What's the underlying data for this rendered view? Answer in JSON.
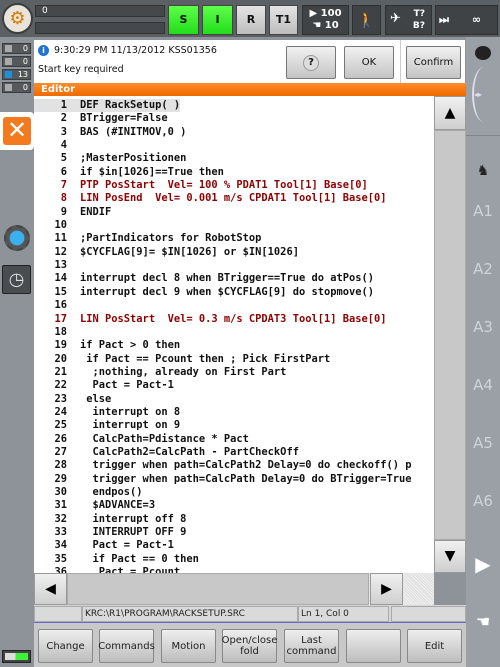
{
  "topbar": {
    "status_line1": "0",
    "status_line2": "",
    "submit_label": "S",
    "interpreter_label": "I",
    "robot_label": "R",
    "mode_label": "T1",
    "program_override": "100",
    "jog_override": "10",
    "tool_label": "T?",
    "base_label": "B?",
    "increment_label": "∞"
  },
  "left": {
    "counters": [
      {
        "icon": "ack-icon",
        "value": "0"
      },
      {
        "icon": "status-icon",
        "value": "0"
      },
      {
        "icon": "info-icon",
        "value": "13"
      },
      {
        "icon": "wait-icon",
        "value": "0"
      }
    ]
  },
  "message": {
    "icon": "info-icon",
    "header": "9:30:29 PM 11/13/2012 KSS01356",
    "text": "Start key required",
    "help_label": "?",
    "ok_label": "OK",
    "confirm_all_label": "Confirm all"
  },
  "editor": {
    "title": "Editor",
    "lines": [
      {
        "n": "1",
        "t": "DEF RackSetup( )"
      },
      {
        "n": "2",
        "t": "BTrigger=False"
      },
      {
        "n": "3",
        "t": "BAS (#INITMOV,0 )"
      },
      {
        "n": "4",
        "t": ""
      },
      {
        "n": "5",
        "t": ";MasterPositionen"
      },
      {
        "n": "6",
        "t": "if $in[1026]==True then"
      },
      {
        "n": "7",
        "t": "PTP PosStart  Vel= 100 % PDAT1 Tool[1] Base[0]",
        "red": true
      },
      {
        "n": "8",
        "t": "LIN PosEnd  Vel= 0.001 m/s CPDAT1 Tool[1] Base[0]",
        "red": true
      },
      {
        "n": "9",
        "t": "ENDIF"
      },
      {
        "n": "10",
        "t": ""
      },
      {
        "n": "11",
        "t": ";PartIndicators for RobotStop"
      },
      {
        "n": "12",
        "t": "$CYCFLAG[9]= $IN[1026] or $IN[1026]"
      },
      {
        "n": "13",
        "t": ""
      },
      {
        "n": "14",
        "t": "interrupt decl 8 when BTrigger==True do atPos()"
      },
      {
        "n": "15",
        "t": "interrupt decl 9 when $CYCFLAG[9] do stopmove()"
      },
      {
        "n": "16",
        "t": ""
      },
      {
        "n": "17",
        "t": "LIN PosStart  Vel= 0.3 m/s CPDAT3 Tool[1] Base[0]",
        "red": true
      },
      {
        "n": "18",
        "t": ""
      },
      {
        "n": "19",
        "t": "if Pact > 0 then"
      },
      {
        "n": "20",
        "t": " if Pact == Pcount then ; Pick FirstPart"
      },
      {
        "n": "21",
        "t": "  ;nothing, already on First Part"
      },
      {
        "n": "22",
        "t": "  Pact = Pact-1"
      },
      {
        "n": "23",
        "t": " else"
      },
      {
        "n": "24",
        "t": "  interrupt on 8"
      },
      {
        "n": "25",
        "t": "  interrupt on 9"
      },
      {
        "n": "26",
        "t": "  CalcPath=Pdistance * Pact"
      },
      {
        "n": "27",
        "t": "  CalcPath2=CalcPath - PartCheckOff"
      },
      {
        "n": "28",
        "t": "  trigger when path=CalcPath2 Delay=0 do checkoff() p"
      },
      {
        "n": "29",
        "t": "  trigger when path=CalcPath Delay=0 do BTrigger=True"
      },
      {
        "n": "30",
        "t": "  endpos()"
      },
      {
        "n": "31",
        "t": "  $ADVANCE=3"
      },
      {
        "n": "32",
        "t": "  interrupt off 8"
      },
      {
        "n": "33",
        "t": "  INTERRUPT OFF 9"
      },
      {
        "n": "34",
        "t": "  Pact = Pact-1"
      },
      {
        "n": "35",
        "t": "  if Pact == 0 then"
      },
      {
        "n": "36",
        "t": "   Pact = Pcount"
      }
    ]
  },
  "statusbar": {
    "path": "KRC:\\R1\\PROGRAM\\RACKSETUP.SRC",
    "position": "Ln 1, Col 0"
  },
  "softkeys": [
    "Change",
    "Commands",
    "Motion",
    "Open/close\nfold",
    "Last\ncommand",
    "",
    "Edit"
  ],
  "right": {
    "axes": [
      "A1",
      "A2",
      "A3",
      "A4",
      "A5",
      "A6"
    ]
  },
  "colors": {
    "accent": "#f07000",
    "active_green": "#2fe020",
    "code_red": "#8b0000"
  }
}
